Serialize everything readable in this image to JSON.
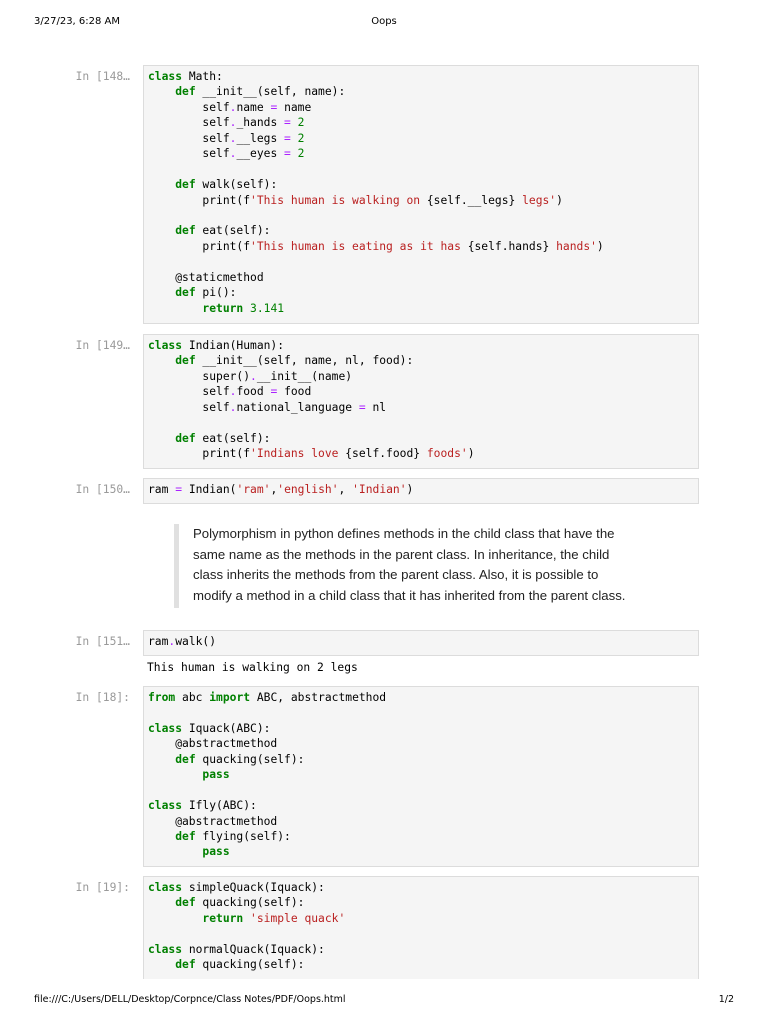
{
  "header": {
    "datetime": "3/27/23, 6:28 AM",
    "title": "Oops"
  },
  "footer": {
    "path": "file:///C:/Users/DELL/Desktop/Corpnce/Class Notes/PDF/Oops.html",
    "page": "1/2"
  },
  "cells": [
    {
      "prompt": "In [148…",
      "lines": [
        [
          [
            "kw",
            "class"
          ],
          [
            "t",
            " Math:"
          ]
        ],
        [
          [
            "t",
            "    "
          ],
          [
            "kw",
            "def"
          ],
          [
            "t",
            " __init__(self, name):"
          ]
        ],
        [
          [
            "t",
            "        self"
          ],
          [
            "op",
            "."
          ],
          [
            "t",
            "name "
          ],
          [
            "op",
            "="
          ],
          [
            "t",
            " name"
          ]
        ],
        [
          [
            "t",
            "        self"
          ],
          [
            "op",
            "."
          ],
          [
            "t",
            "_hands "
          ],
          [
            "op",
            "="
          ],
          [
            "t",
            " "
          ],
          [
            "num",
            "2"
          ]
        ],
        [
          [
            "t",
            "        self"
          ],
          [
            "op",
            "."
          ],
          [
            "t",
            "__legs "
          ],
          [
            "op",
            "="
          ],
          [
            "t",
            " "
          ],
          [
            "num",
            "2"
          ]
        ],
        [
          [
            "t",
            "        self"
          ],
          [
            "op",
            "."
          ],
          [
            "t",
            "__eyes "
          ],
          [
            "op",
            "="
          ],
          [
            "t",
            " "
          ],
          [
            "num",
            "2"
          ]
        ],
        [
          [
            "t",
            ""
          ]
        ],
        [
          [
            "t",
            "    "
          ],
          [
            "kw",
            "def"
          ],
          [
            "t",
            " walk(self):"
          ]
        ],
        [
          [
            "t",
            "        print(f"
          ],
          [
            "str",
            "'This human is walking on "
          ],
          [
            "t",
            "{self.__legs}"
          ],
          [
            "str",
            " legs'"
          ],
          [
            "t",
            ")"
          ]
        ],
        [
          [
            "t",
            ""
          ]
        ],
        [
          [
            "t",
            "    "
          ],
          [
            "kw",
            "def"
          ],
          [
            "t",
            " eat(self):"
          ]
        ],
        [
          [
            "t",
            "        print(f"
          ],
          [
            "str",
            "'This human is eating as it has "
          ],
          [
            "t",
            "{self.hands}"
          ],
          [
            "str",
            " hands'"
          ],
          [
            "t",
            ")"
          ]
        ],
        [
          [
            "t",
            ""
          ]
        ],
        [
          [
            "t",
            "    @staticmethod"
          ]
        ],
        [
          [
            "t",
            "    "
          ],
          [
            "kw",
            "def"
          ],
          [
            "t",
            " pi():"
          ]
        ],
        [
          [
            "t",
            "        "
          ],
          [
            "kw",
            "return"
          ],
          [
            "t",
            " "
          ],
          [
            "num",
            "3.141"
          ]
        ]
      ]
    },
    {
      "prompt": "In [149…",
      "lines": [
        [
          [
            "kw",
            "class"
          ],
          [
            "t",
            " Indian(Human):"
          ]
        ],
        [
          [
            "t",
            "    "
          ],
          [
            "kw",
            "def"
          ],
          [
            "t",
            " __init__(self, name, nl, food):"
          ]
        ],
        [
          [
            "t",
            "        super()"
          ],
          [
            "op",
            "."
          ],
          [
            "t",
            "__init__(name)"
          ]
        ],
        [
          [
            "t",
            "        self"
          ],
          [
            "op",
            "."
          ],
          [
            "t",
            "food "
          ],
          [
            "op",
            "="
          ],
          [
            "t",
            " food"
          ]
        ],
        [
          [
            "t",
            "        self"
          ],
          [
            "op",
            "."
          ],
          [
            "t",
            "national_language "
          ],
          [
            "op",
            "="
          ],
          [
            "t",
            " nl"
          ]
        ],
        [
          [
            "t",
            ""
          ]
        ],
        [
          [
            "t",
            "    "
          ],
          [
            "kw",
            "def"
          ],
          [
            "t",
            " eat(self):"
          ]
        ],
        [
          [
            "t",
            "        print(f"
          ],
          [
            "str",
            "'Indians love "
          ],
          [
            "t",
            "{self.food}"
          ],
          [
            "str",
            " foods'"
          ],
          [
            "t",
            ")"
          ]
        ]
      ]
    },
    {
      "prompt": "In [150…",
      "lines": [
        [
          [
            "t",
            "ram "
          ],
          [
            "op",
            "="
          ],
          [
            "t",
            " Indian("
          ],
          [
            "str",
            "'ram'"
          ],
          [
            "t",
            ","
          ],
          [
            "str",
            "'english'"
          ],
          [
            "t",
            ", "
          ],
          [
            "str",
            "'Indian'"
          ],
          [
            "t",
            ")"
          ]
        ]
      ]
    },
    {
      "prompt": "In [151…",
      "lines": [
        [
          [
            "t",
            "ram"
          ],
          [
            "op",
            "."
          ],
          [
            "t",
            "walk()"
          ]
        ]
      ],
      "output": [
        "This human is walking on 2 legs"
      ]
    },
    {
      "prompt": "In [18]:",
      "lines": [
        [
          [
            "kw",
            "from"
          ],
          [
            "t",
            " abc "
          ],
          [
            "kw",
            "import"
          ],
          [
            "t",
            " ABC, abstractmethod"
          ]
        ],
        [
          [
            "t",
            ""
          ]
        ],
        [
          [
            "kw",
            "class"
          ],
          [
            "t",
            " Iquack(ABC):"
          ]
        ],
        [
          [
            "t",
            "    @abstractmethod"
          ]
        ],
        [
          [
            "t",
            "    "
          ],
          [
            "kw",
            "def"
          ],
          [
            "t",
            " quacking(self):"
          ]
        ],
        [
          [
            "t",
            "        "
          ],
          [
            "kw",
            "pass"
          ]
        ],
        [
          [
            "t",
            ""
          ]
        ],
        [
          [
            "kw",
            "class"
          ],
          [
            "t",
            " Ifly(ABC):"
          ]
        ],
        [
          [
            "t",
            "    @abstractmethod"
          ]
        ],
        [
          [
            "t",
            "    "
          ],
          [
            "kw",
            "def"
          ],
          [
            "t",
            " flying(self):"
          ]
        ],
        [
          [
            "t",
            "        "
          ],
          [
            "kw",
            "pass"
          ]
        ]
      ]
    },
    {
      "prompt": "In [19]:",
      "lines": [
        [
          [
            "kw",
            "class"
          ],
          [
            "t",
            " simpleQuack(Iquack):"
          ]
        ],
        [
          [
            "t",
            "    "
          ],
          [
            "kw",
            "def"
          ],
          [
            "t",
            " quacking(self):"
          ]
        ],
        [
          [
            "t",
            "        "
          ],
          [
            "kw",
            "return"
          ],
          [
            "t",
            " "
          ],
          [
            "str",
            "'simple quack'"
          ]
        ],
        [
          [
            "t",
            ""
          ]
        ],
        [
          [
            "kw",
            "class"
          ],
          [
            "t",
            " normalQuack(Iquack):"
          ]
        ],
        [
          [
            "t",
            "    "
          ],
          [
            "kw",
            "def"
          ],
          [
            "t",
            " quacking(self):"
          ]
        ]
      ]
    }
  ],
  "markdown": {
    "text": "Polymorphism in python defines methods in the child class that have the same name as the methods in the parent class. In inheritance, the child class inherits the methods from the parent class. Also, it is possible to modify a method in a child class that it has inherited from the parent class.",
    "lines": [
      "Polymorphism in python defines methods in the child class that have the",
      "same name as the methods in the parent class. In inheritance, the child",
      "class inherits the methods from the parent class. Also, it is possible to",
      "modify a method in a child class that it has inherited from the parent class."
    ]
  }
}
